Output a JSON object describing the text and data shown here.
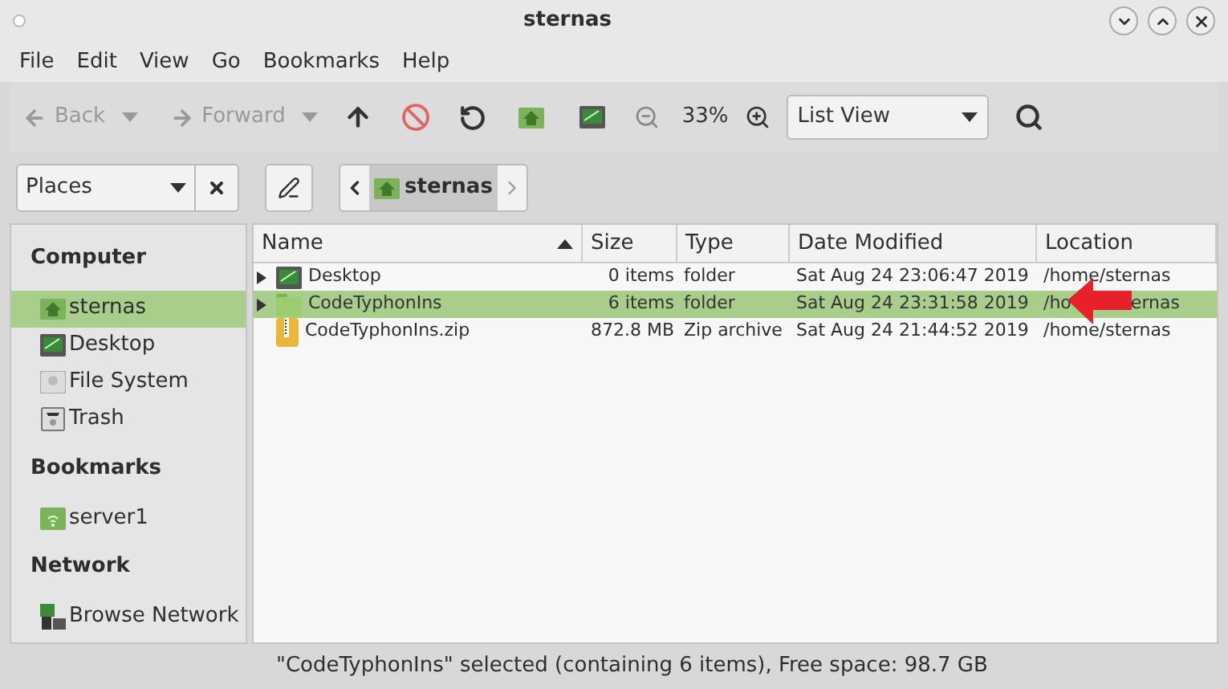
{
  "window": {
    "title": "sternas"
  },
  "menu": [
    "File",
    "Edit",
    "View",
    "Go",
    "Bookmarks",
    "Help"
  ],
  "toolbar": {
    "back": "Back",
    "forward": "Forward",
    "zoom": "33%",
    "view": "List View"
  },
  "places_select": "Places",
  "path": [
    {
      "label": "sternas",
      "selected": true
    }
  ],
  "sidebar": [
    {
      "heading": "Computer",
      "items": [
        {
          "label": "sternas",
          "kind": "home",
          "selected": true
        },
        {
          "label": "Desktop",
          "kind": "desktop",
          "selected": false
        },
        {
          "label": "File System",
          "kind": "drive",
          "selected": false
        },
        {
          "label": "Trash",
          "kind": "trash",
          "selected": false
        }
      ]
    },
    {
      "heading": "Bookmarks",
      "items": [
        {
          "label": "server1",
          "kind": "server",
          "selected": false
        }
      ]
    },
    {
      "heading": "Network",
      "items": [
        {
          "label": "Browse Network",
          "kind": "network",
          "selected": false
        }
      ]
    }
  ],
  "table": {
    "columns": [
      "Name",
      "Size",
      "Type",
      "Date Modified",
      "Location"
    ],
    "rows": [
      {
        "name": "Desktop",
        "kind": "desktop",
        "expandable": true,
        "size": "0 items",
        "type": "folder",
        "modified": "Sat Aug 24 23:06:47 2019",
        "location": "/home/sternas",
        "selected": false
      },
      {
        "name": "CodeTyphonIns",
        "kind": "folder",
        "expandable": true,
        "size": "6 items",
        "type": "folder",
        "modified": "Sat Aug 24 23:31:58 2019",
        "location": "/ho",
        "location_after_arrow": "ernas",
        "selected": true
      },
      {
        "name": "CodeTyphonIns.zip",
        "kind": "zip",
        "expandable": false,
        "size": "872.8 MB",
        "type": "Zip archive",
        "modified": "Sat Aug 24 21:44:52 2019",
        "location": "/home/sternas",
        "selected": false
      }
    ]
  },
  "status_bar": "\"CodeTyphonIns\" selected (containing 6 items), Free space: 98.7 GB"
}
